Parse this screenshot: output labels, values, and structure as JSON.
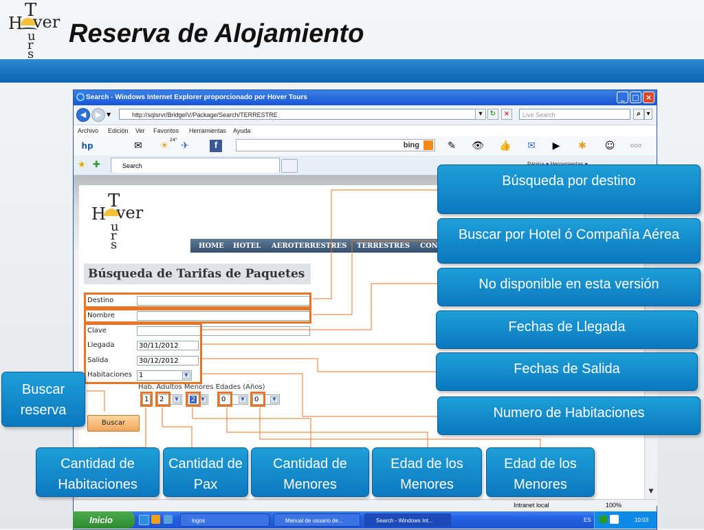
{
  "slide": {
    "logo": {
      "t": "T",
      "h": "H",
      "ver": "ver",
      "urs": "u\nr\ns"
    },
    "title": "Reserva de Alojamiento"
  },
  "browser": {
    "window_title": "Search - Windows Internet Explorer proporcionado por Hover Tours",
    "url": "http://sqlsrvr/BridgeIV/Package/Search/TERRESTRE",
    "search_placeholder": "Live Search",
    "menu": [
      "Archivo",
      "Edición",
      "Ver",
      "Favoritos",
      "Herramientas",
      "Ayuda"
    ],
    "toolbar_search_brand": "bing",
    "weather": "24°",
    "tab_label": "Search",
    "more_menu": "Página ▾  Herramientas ▾",
    "status_zone": "Intranet local",
    "zoom": "100%"
  },
  "page": {
    "logo": {
      "t": "T",
      "h": "H",
      "ver": "ver",
      "urs": "u\nr\ns"
    },
    "nav": [
      "HOME",
      "HOTEL",
      "AEROTERRESTRES",
      "TERRESTRES",
      "CON"
    ],
    "heading": "Búsqueda de Tarifas de Paquetes",
    "form": {
      "destino_label": "Destino",
      "destino_value": "",
      "nombre_label": "Nombre",
      "nombre_value": "",
      "clave_label": "Clave",
      "clave_value": "",
      "llegada_label": "Llegada",
      "llegada_value": "30/11/2012",
      "salida_label": "Salida",
      "salida_value": "30/12/2012",
      "habitaciones_label": "Habitaciones",
      "habitaciones_value": "1"
    },
    "room_header": "Hab. Adultos Menores   Edades (Años)",
    "room_row": {
      "hab": "1",
      "adultos": "2",
      "menores": "2",
      "edad1": "0",
      "edad2": "0"
    },
    "search_button": "Buscar"
  },
  "taskbar": {
    "start": "Inicio",
    "tasks": [
      "logos",
      "Manual de usuario de...",
      "Search - Windows Int..."
    ],
    "lang": "ES",
    "clock": "10:03"
  },
  "callouts": {
    "busqueda_destino": "Búsqueda por destino",
    "buscar_hotel": "Buscar por Hotel ó Compañía Aérea",
    "no_disponible": "No disponible en esta versión",
    "fechas_llegada": "Fechas de Llegada",
    "fechas_salida": "Fechas de Salida",
    "numero_habitaciones": "Numero de Habitaciones",
    "buscar_reserva": "Buscar reserva",
    "cantidad_habitaciones": "Cantidad de Habitaciones",
    "cantidad_pax": "Cantidad de Pax",
    "cantidad_menores": "Cantidad de Menores",
    "edad_menores_1": "Edad de los Menores",
    "edad_menores_2": "Edad de los Menores"
  },
  "colors": {
    "accent": "#1a8fd2",
    "highlight": "#e8742a",
    "banner": "#1d7ac4"
  }
}
